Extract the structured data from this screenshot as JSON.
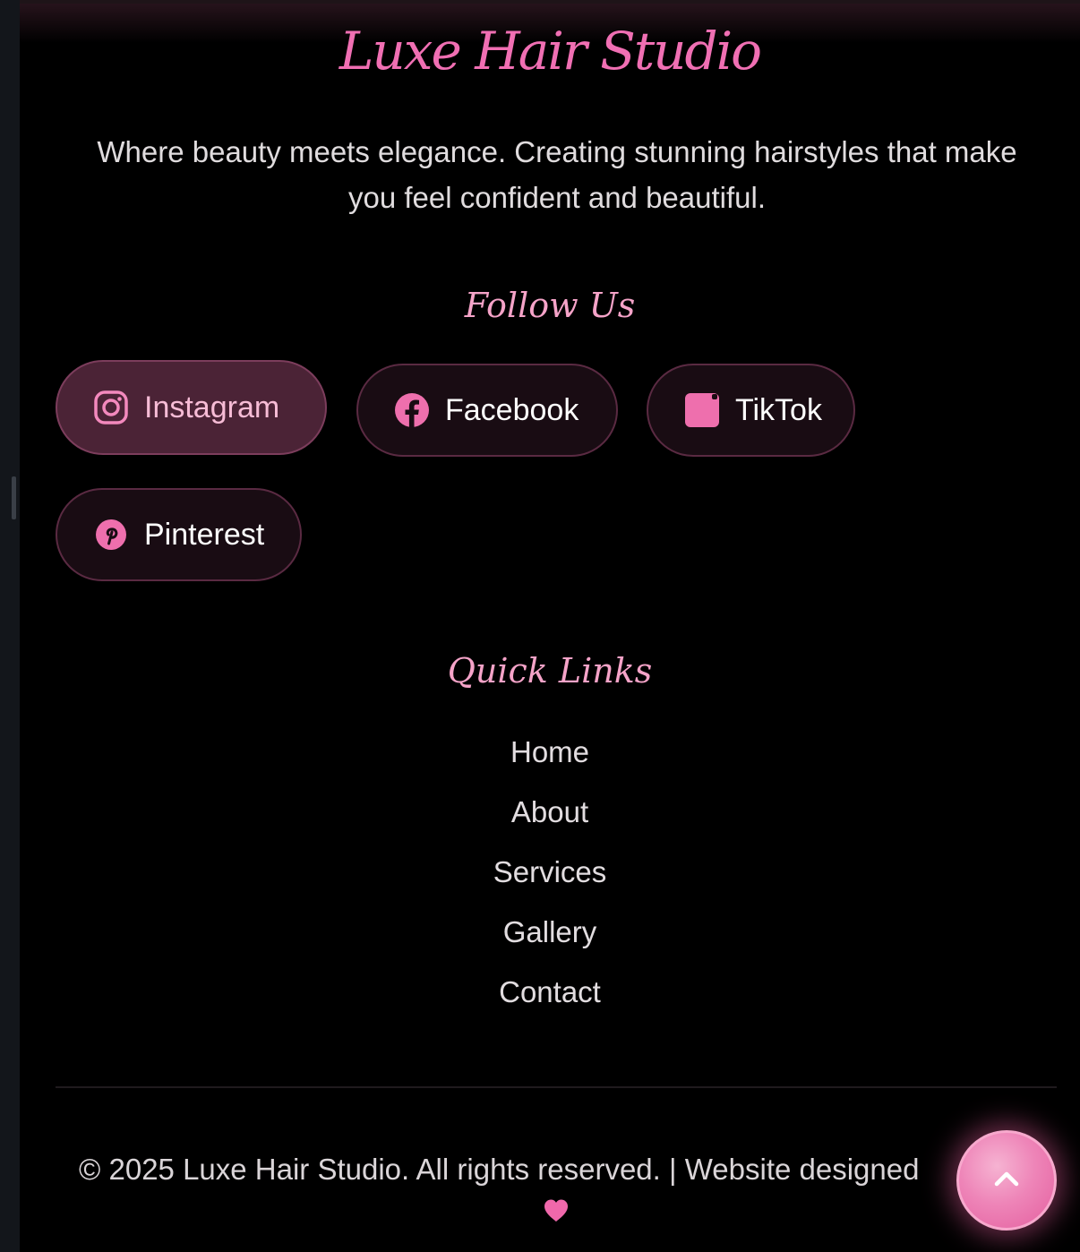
{
  "brand": {
    "name": "Luxe Hair Studio",
    "accent_color": "#f06fb3"
  },
  "tagline": "Where beauty meets elegance. Creating stunning hairstyles that make you feel confident and beautiful.",
  "follow": {
    "heading": "Follow Us",
    "links": [
      {
        "label": "Instagram",
        "icon": "instagram-icon",
        "active": true
      },
      {
        "label": "Facebook",
        "icon": "facebook-icon",
        "active": false
      },
      {
        "label": "TikTok",
        "icon": "tiktok-icon",
        "active": false
      },
      {
        "label": "Pinterest",
        "icon": "pinterest-icon",
        "active": false
      }
    ]
  },
  "quick_links": {
    "heading": "Quick Links",
    "items": [
      "Home",
      "About",
      "Services",
      "Gallery",
      "Contact"
    ]
  },
  "footer": {
    "copyright": "© 2025 Luxe Hair Studio. All rights reserved. | Website designed",
    "heart_icon": "heart-icon"
  },
  "back_to_top": {
    "icon": "chevron-up-icon"
  }
}
